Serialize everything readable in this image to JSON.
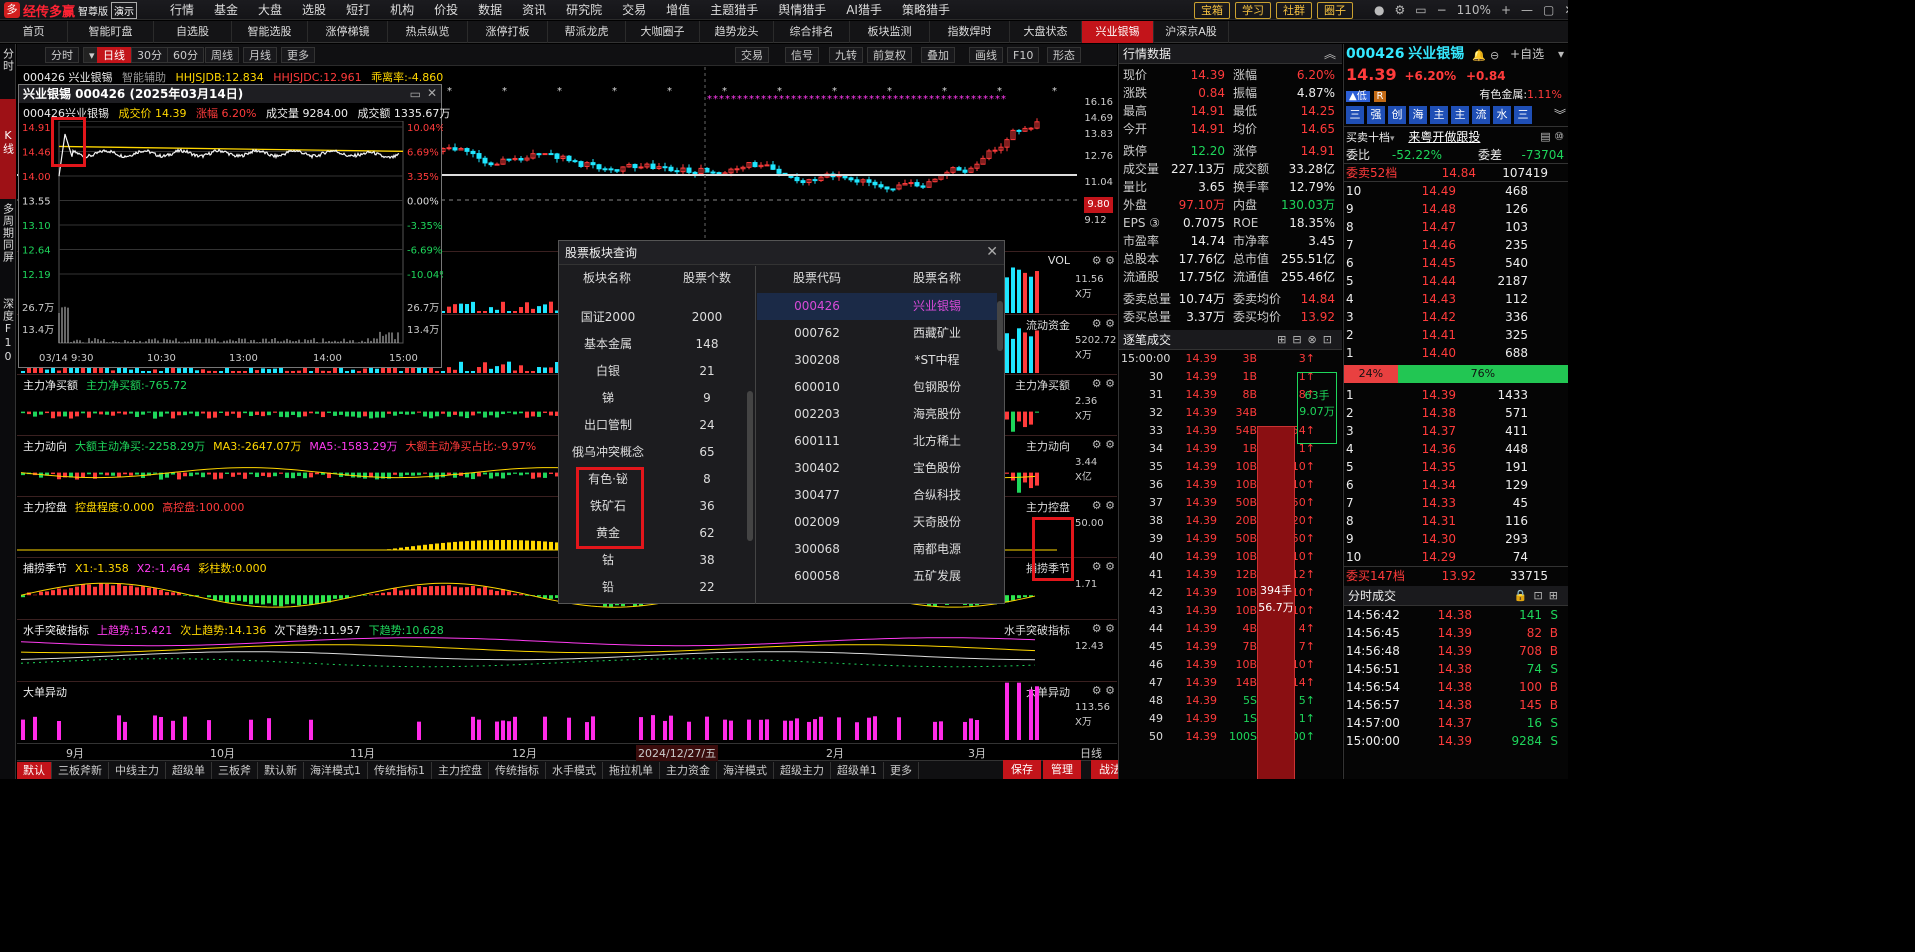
{
  "app": {
    "logo_text": "经传多赢",
    "edition": "智尊版",
    "demo": "演示",
    "menu": [
      {
        "label": "行情"
      },
      {
        "label": "基金"
      },
      {
        "label": "大盘"
      },
      {
        "label": "选股"
      },
      {
        "label": "短打"
      },
      {
        "label": "机构"
      },
      {
        "label": "价投"
      },
      {
        "label": "数据"
      },
      {
        "label": "资讯"
      },
      {
        "label": "研究院"
      },
      {
        "label": "交易"
      },
      {
        "label": "增值"
      },
      {
        "label": "主题猎手"
      },
      {
        "label": "舆情猎手"
      },
      {
        "label": "AI猎手"
      },
      {
        "label": "策略猎手"
      }
    ],
    "top_buttons": [
      "宝箱",
      "学习",
      "社群",
      "圈子"
    ],
    "zoom": "110%",
    "tabs": [
      {
        "label": "首页"
      },
      {
        "label": "智能盯盘"
      },
      {
        "label": "自选股"
      },
      {
        "label": "智能选股"
      },
      {
        "label": "涨停梯镜"
      },
      {
        "label": "热点纵览"
      },
      {
        "label": "涨停打板"
      },
      {
        "label": "帮派龙虎"
      },
      {
        "label": "大咖圈子"
      },
      {
        "label": "趋势龙头"
      },
      {
        "label": "综合排名"
      },
      {
        "label": "板块监测"
      },
      {
        "label": "指数焊时"
      },
      {
        "label": "大盘状态"
      },
      {
        "label": "兴业银锡"
      },
      {
        "label": "沪深京A股"
      }
    ],
    "left_side": [
      "分时",
      "K线",
      "多周期同屏",
      "深度F10"
    ]
  },
  "chart_toolbar": {
    "left": [
      "分时",
      "日线",
      "30分",
      "60分",
      "周线",
      "月线",
      "更多"
    ],
    "right": [
      "交易",
      "信号",
      "九转",
      "前复权",
      "叠加",
      "画线",
      "F10",
      "形态"
    ]
  },
  "main_chart": {
    "code_name": "000426 兴业银锡",
    "assist": "智能辅助",
    "hhjsjdb": "HHJSJDB:12.834",
    "hhjsjdc": "HHJSJDC:12.961",
    "ratio": "乖离率:-4.860",
    "axis": [
      "16.16",
      "14.69",
      "13.83",
      "12.76",
      "11.04",
      "9.80",
      "9.12"
    ],
    "price_label": "9.80",
    "chart_data": {
      "type": "candlestick",
      "xlabels": [
        "9月",
        "10月",
        "11月",
        "12月",
        "2024/12/27/五",
        "2月",
        "3月",
        "日线"
      ],
      "last_close": 14.39,
      "ylim": [
        9.12,
        16.16
      ]
    }
  },
  "mini_chart": {
    "title": "兴业银锡 000426 (2025年03月14日)",
    "line2": [
      "000426兴业银锡",
      "成交价 14.39",
      "涨幅 6.20%",
      "成交量 9284.00",
      "成交额 1335.67万"
    ],
    "left_axis": [
      "14.91",
      "14.46",
      "14.00",
      "13.55",
      "13.10",
      "12.64",
      "12.19",
      "26.7万",
      "13.4万"
    ],
    "right_axis": [
      "10.04%",
      "6.69%",
      "3.35%",
      "0.00%",
      "-3.35%",
      "-6.69%",
      "-10.04%",
      "26.7万",
      "13.4万"
    ],
    "x_axis": [
      "03/14 9:30",
      "10:30",
      "13:00",
      "14:00",
      "15:00"
    ],
    "chart_data": {
      "type": "line",
      "series": [
        {
          "name": "成交价",
          "values": [
            14.0,
            14.75,
            14.3,
            14.65,
            14.5,
            14.45,
            14.42,
            14.4,
            14.39
          ]
        }
      ],
      "ylim": [
        12.19,
        14.91
      ]
    }
  },
  "panes": [
    {
      "id": "vol",
      "label": "VOL",
      "axis": [
        "11.56",
        "X万"
      ]
    },
    {
      "id": "flow",
      "label": "流动资金",
      "axis": [
        "5202.72",
        "X万"
      ]
    },
    {
      "id": "zljmm",
      "header": "主力净买额",
      "items": [
        {
          "text": "主力净买额:-765.72",
          "cls": "grn"
        }
      ],
      "label": "主力净买额",
      "axis": [
        "2.36",
        "X万"
      ]
    },
    {
      "id": "zldx",
      "header": "主力动向",
      "items": [
        {
          "text": "大额主动净买:-2258.29万",
          "cls": "grn"
        },
        {
          "text": "MA3:-2647.07万",
          "cls": "yel"
        },
        {
          "text": "MA5:-1583.29万",
          "cls": "mag"
        },
        {
          "text": "大额主动净买占比:-9.97%",
          "cls": "red"
        }
      ],
      "label": "主力动向",
      "axis": [
        "3.44",
        "X亿"
      ]
    },
    {
      "id": "zlkp",
      "header": "主力控盘",
      "items": [
        {
          "text": "控盘程度:0.000",
          "cls": "yel"
        },
        {
          "text": "高控盘:100.000",
          "cls": "red"
        }
      ],
      "label": "主力控盘",
      "axis": [
        "50.00"
      ]
    },
    {
      "id": "bl",
      "header": "捕捞季节",
      "items": [
        {
          "text": "X1:-1.358",
          "cls": "yel"
        },
        {
          "text": "X2:-1.464",
          "cls": "mag"
        },
        {
          "text": "彩柱数:0.000",
          "cls": "yel"
        }
      ],
      "label": "捕捞季节",
      "axis": [
        "1.71"
      ]
    },
    {
      "id": "ss",
      "header": "水手突破指标",
      "items": [
        {
          "text": "上趋势:15.421",
          "cls": "mag"
        },
        {
          "text": "次上趋势:14.136",
          "cls": "yel"
        },
        {
          "text": "次下趋势:11.957",
          "cls": "wht"
        },
        {
          "text": "下趋势:10.628",
          "cls": "grn"
        }
      ],
      "label": "水手突破指标",
      "axis": [
        "12.43"
      ]
    },
    {
      "id": "dd",
      "header": "大单异动",
      "items": [],
      "label": "大单异动",
      "axis": [
        "113.56",
        "X万"
      ]
    }
  ],
  "dialog": {
    "title": "股票板块查询",
    "col_left": [
      "板块名称",
      "股票个数"
    ],
    "col_right": [
      "股票代码",
      "股票名称"
    ],
    "sectors": [
      {
        "name": "国证2000",
        "count": "2000"
      },
      {
        "name": "基本金属",
        "count": "148"
      },
      {
        "name": "白银",
        "count": "21"
      },
      {
        "name": "锑",
        "count": "9"
      },
      {
        "name": "出口管制",
        "count": "24"
      },
      {
        "name": "俄乌冲突概念",
        "count": "65"
      },
      {
        "name": "有色·铋",
        "count": "8"
      },
      {
        "name": "铁矿石",
        "count": "36"
      },
      {
        "name": "黄金",
        "count": "62"
      },
      {
        "name": "钴",
        "count": "38"
      },
      {
        "name": "铅",
        "count": "22"
      }
    ],
    "stocks": [
      {
        "code": "000426",
        "name": "兴业银锡"
      },
      {
        "code": "000762",
        "name": "西藏矿业"
      },
      {
        "code": "300208",
        "name": "*ST中程"
      },
      {
        "code": "600010",
        "name": "包钢股份"
      },
      {
        "code": "002203",
        "name": "海亮股份"
      },
      {
        "code": "600111",
        "name": "北方稀土"
      },
      {
        "code": "300402",
        "name": "宝色股份"
      },
      {
        "code": "300477",
        "name": "合纵科技"
      },
      {
        "code": "002009",
        "name": "天奇股份"
      },
      {
        "code": "300068",
        "name": "南都电源"
      },
      {
        "code": "600058",
        "name": "五矿发展"
      }
    ]
  },
  "quote": {
    "header": "行情数据",
    "rows": [
      [
        {
          "l": "现价",
          "v": "14.39",
          "c": "red"
        },
        {
          "l": "涨幅",
          "v": "6.20%",
          "c": "red"
        }
      ],
      [
        {
          "l": "涨跌",
          "v": "0.84",
          "c": "red"
        },
        {
          "l": "振幅",
          "v": "4.87%",
          "c": "wht"
        }
      ],
      [
        {
          "l": "最高",
          "v": "14.91",
          "c": "red"
        },
        {
          "l": "最低",
          "v": "14.25",
          "c": "red"
        }
      ],
      [
        {
          "l": "今开",
          "v": "14.91",
          "c": "red"
        },
        {
          "l": "均价",
          "v": "14.65",
          "c": "red"
        }
      ],
      [
        {
          "l": "跌停",
          "v": "12.20",
          "c": "grn"
        },
        {
          "l": "涨停",
          "v": "14.91",
          "c": "red"
        }
      ],
      [
        {
          "l": "成交量",
          "v": "227.13万",
          "c": "wht"
        },
        {
          "l": "成交额",
          "v": "33.28亿",
          "c": "wht"
        }
      ],
      [
        {
          "l": "量比",
          "v": "3.65",
          "c": "wht"
        },
        {
          "l": "换手率",
          "v": "12.79%",
          "c": "wht"
        }
      ],
      [
        {
          "l": "外盘",
          "v": "97.10万",
          "c": "red"
        },
        {
          "l": "内盘",
          "v": "130.03万",
          "c": "grn"
        }
      ],
      [
        {
          "l": "EPS ③",
          "v": "0.7075",
          "c": "wht"
        },
        {
          "l": "ROE",
          "v": "18.35%",
          "c": "wht"
        }
      ],
      [
        {
          "l": "市盈率",
          "v": "14.74",
          "c": "wht"
        },
        {
          "l": "市净率",
          "v": "3.45",
          "c": "wht"
        }
      ],
      [
        {
          "l": "总股本",
          "v": "17.76亿",
          "c": "wht"
        },
        {
          "l": "总市值",
          "v": "255.51亿",
          "c": "wht"
        }
      ],
      [
        {
          "l": "流通股",
          "v": "17.75亿",
          "c": "wht"
        },
        {
          "l": "流通值",
          "v": "255.46亿",
          "c": "wht"
        }
      ],
      [
        {
          "l": "委卖总量",
          "v": "10.74万",
          "c": "wht"
        },
        {
          "l": "委卖均价",
          "v": "14.84",
          "c": "red"
        }
      ],
      [
        {
          "l": "委买总量",
          "v": "3.37万",
          "c": "wht"
        },
        {
          "l": "委买均价",
          "v": "13.92",
          "c": "red"
        }
      ]
    ],
    "tick_header": "逐笔成交",
    "ticks": [
      {
        "t": "15:00:00",
        "p": "14.39",
        "v": "3B",
        "s": "3"
      },
      {
        "t": "30",
        "p": "14.39",
        "v": "1B",
        "s": "1"
      },
      {
        "t": "31",
        "p": "14.39",
        "v": "8B",
        "s": "8"
      },
      {
        "t": "32",
        "p": "14.39",
        "v": "34B",
        "s": ""
      },
      {
        "t": "33",
        "p": "14.39",
        "v": "54B",
        "s": "54"
      },
      {
        "t": "34",
        "p": "14.39",
        "v": "1B",
        "s": "1"
      },
      {
        "t": "35",
        "p": "14.39",
        "v": "10B",
        "s": "10"
      },
      {
        "t": "36",
        "p": "14.39",
        "v": "10B",
        "s": "10"
      },
      {
        "t": "37",
        "p": "14.39",
        "v": "50B",
        "s": "50"
      },
      {
        "t": "38",
        "p": "14.39",
        "v": "20B",
        "s": "20"
      },
      {
        "t": "39",
        "p": "14.39",
        "v": "50B",
        "s": "50"
      },
      {
        "t": "40",
        "p": "14.39",
        "v": "10B",
        "s": "10"
      },
      {
        "t": "41",
        "p": "14.39",
        "v": "12B",
        "s": "12"
      },
      {
        "t": "42",
        "p": "14.39",
        "v": "10B",
        "s": "10"
      },
      {
        "t": "43",
        "p": "14.39",
        "v": "10B",
        "s": "10"
      },
      {
        "t": "44",
        "p": "14.39",
        "v": "4B",
        "s": "4"
      },
      {
        "t": "45",
        "p": "14.39",
        "v": "7B",
        "s": "7"
      },
      {
        "t": "46",
        "p": "14.39",
        "v": "10B",
        "s": "10"
      },
      {
        "t": "47",
        "p": "14.39",
        "v": "14B",
        "s": "14"
      },
      {
        "t": "48",
        "p": "14.39",
        "v": "5S",
        "s": "5"
      },
      {
        "t": "49",
        "p": "14.39",
        "v": "1S",
        "s": "1"
      },
      {
        "t": "50",
        "p": "14.39",
        "v": "100S",
        "s": "100"
      }
    ],
    "tick_box1": "63手",
    "tick_box2": "9.07万",
    "tick_box3": "394手",
    "tick_box4": "56.7万"
  },
  "level2": {
    "code": "000426",
    "name": "兴业银锡",
    "price": "14.39",
    "chg": "+6.20%",
    "diff": "+0.84",
    "fav": "自选",
    "sector": "有色金属:",
    "sector_chg": "1.11%",
    "icons": [
      "三",
      "强",
      "创",
      "海",
      "主",
      "主",
      "流",
      "水",
      "三"
    ],
    "b10_label": "买卖十档",
    "live": "来粤开做跟投",
    "wb": "委比",
    "wb_v": "-52.22%",
    "wc": "委差",
    "wc_v": "-73704",
    "sell_head": "委卖52档",
    "sell_head_p": "14.84",
    "sell_head_v": "107419",
    "sells": [
      {
        "n": "10",
        "p": "14.49",
        "v": "468"
      },
      {
        "n": "9",
        "p": "14.48",
        "v": "126"
      },
      {
        "n": "8",
        "p": "14.47",
        "v": "103"
      },
      {
        "n": "7",
        "p": "14.46",
        "v": "235"
      },
      {
        "n": "6",
        "p": "14.45",
        "v": "540"
      },
      {
        "n": "5",
        "p": "14.44",
        "v": "2187"
      },
      {
        "n": "4",
        "p": "14.43",
        "v": "112"
      },
      {
        "n": "3",
        "p": "14.42",
        "v": "336"
      },
      {
        "n": "2",
        "p": "14.41",
        "v": "325"
      },
      {
        "n": "1",
        "p": "14.40",
        "v": "688"
      }
    ],
    "bar_left": "24%",
    "bar_right": "76%",
    "buys": [
      {
        "n": "1",
        "p": "14.39",
        "v": "1433"
      },
      {
        "n": "2",
        "p": "14.38",
        "v": "571"
      },
      {
        "n": "3",
        "p": "14.37",
        "v": "411"
      },
      {
        "n": "4",
        "p": "14.36",
        "v": "448"
      },
      {
        "n": "5",
        "p": "14.35",
        "v": "191"
      },
      {
        "n": "6",
        "p": "14.34",
        "v": "129"
      },
      {
        "n": "7",
        "p": "14.33",
        "v": "45"
      },
      {
        "n": "8",
        "p": "14.31",
        "v": "116"
      },
      {
        "n": "9",
        "p": "14.30",
        "v": "293"
      },
      {
        "n": "10",
        "p": "14.29",
        "v": "74"
      }
    ],
    "buy_head": "委买147档",
    "buy_head_p": "13.92",
    "buy_head_v": "33715",
    "ftrade_label": "分时成交",
    "ftrades": [
      {
        "t": "14:56:42",
        "p": "14.38",
        "v": "141",
        "s": "S"
      },
      {
        "t": "14:56:45",
        "p": "14.39",
        "v": "82",
        "s": "B"
      },
      {
        "t": "14:56:48",
        "p": "14.39",
        "v": "708",
        "s": "B"
      },
      {
        "t": "14:56:51",
        "p": "14.38",
        "v": "74",
        "s": "S"
      },
      {
        "t": "14:56:54",
        "p": "14.38",
        "v": "100",
        "s": "B"
      },
      {
        "t": "14:56:57",
        "p": "14.38",
        "v": "145",
        "s": "B"
      },
      {
        "t": "14:57:00",
        "p": "14.37",
        "v": "16",
        "s": "S"
      },
      {
        "t": "15:00:00",
        "p": "14.39",
        "v": "9284",
        "s": "S"
      }
    ]
  },
  "bottom": [
    "默认",
    "三板斧新",
    "中线主力",
    "超级单",
    "三板斧",
    "默认新",
    "海洋模式1",
    "传统指标1",
    "主力控盘",
    "传统指标",
    "水手模式",
    "拖拉机单",
    "主力资金",
    "海洋模式",
    "超级主力",
    "超级单1",
    "更多"
  ],
  "bottom_right": [
    "保存",
    "管理",
    "战法"
  ]
}
